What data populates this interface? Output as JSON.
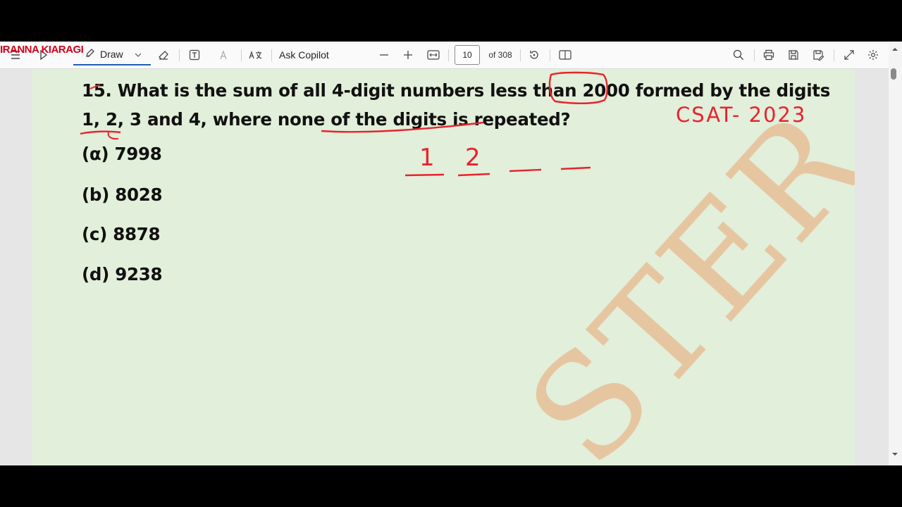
{
  "overlay": {
    "name": "IRANNA KIARAGI"
  },
  "toolbar": {
    "draw_label": "Draw",
    "ask_copilot": "Ask Copilot",
    "page_current": "10",
    "page_total": "of 308"
  },
  "document": {
    "question_line1": "15. What is the sum of all 4-digit numbers less than 2000 formed by the digits",
    "question_line2": "1, 2, 3 and 4, where none of the digits is repeated?",
    "options": [
      {
        "text": "(α) 7998"
      },
      {
        "text": "(b) 8028"
      },
      {
        "text": "(c) 8878"
      },
      {
        "text": "(d) 9238"
      }
    ],
    "annotation_exam": "CSAT- 2023",
    "annotation_digit1": "1",
    "annotation_digit2": "2",
    "stamp_text": "STER"
  },
  "colors": {
    "ink": "#e8232e",
    "page": "#e2efda",
    "accent": "#1e5fb3"
  }
}
